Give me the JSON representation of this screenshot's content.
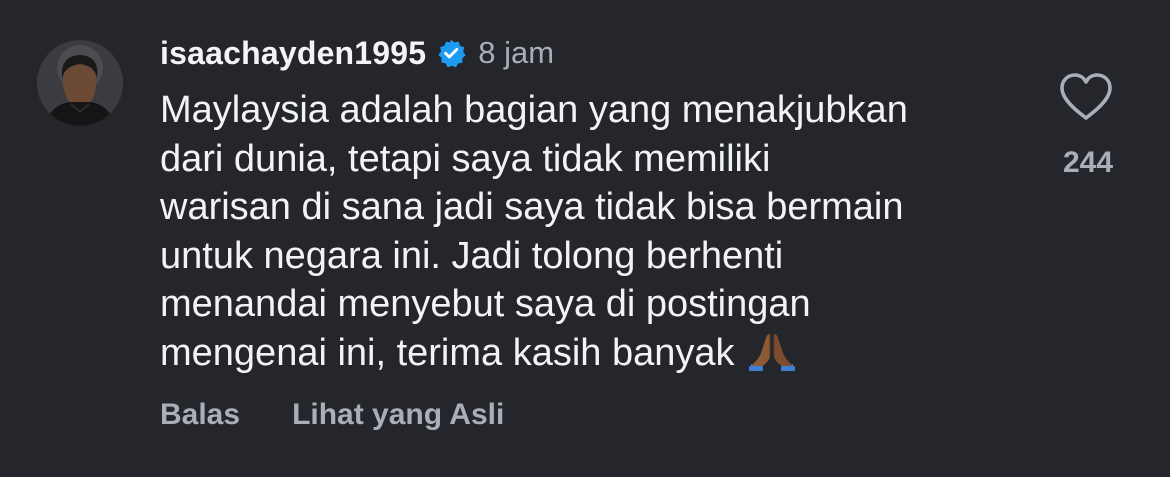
{
  "comment": {
    "username": "isaachayden1995",
    "verified_icon": "verified-badge-icon",
    "time": "8 jam",
    "text_lines": [
      "Maylaysia adalah bagian yang menakjubkan",
      "dari dunia, tetapi saya tidak memiliki",
      "warisan di sana jadi saya tidak bisa bermain",
      "untuk negara ini. Jadi tolong berhenti",
      "menandai menyebut saya di postingan",
      "mengenai ini, terima kasih banyak"
    ],
    "emoji": "🙏🏾",
    "like_icon": "heart-outline-icon",
    "like_count": "244"
  },
  "actions": {
    "reply": "Balas",
    "see_original": "Lihat yang Asli"
  },
  "colors": {
    "background": "#24262b",
    "text": "#f2f3f5",
    "muted": "#a9aeb7",
    "verified": "#1d9bf0"
  }
}
